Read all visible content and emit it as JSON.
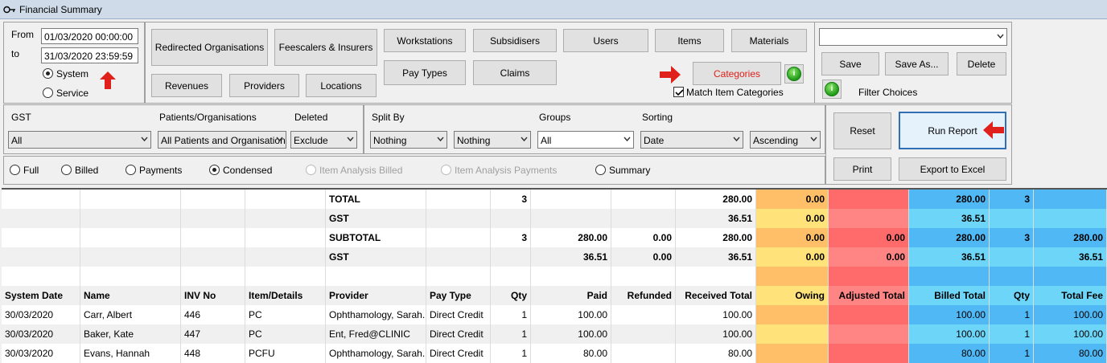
{
  "window": {
    "title": "Financial Summary"
  },
  "date_range": {
    "from_label": "From",
    "to_label": "to",
    "from_value": "01/03/2020 00:00:00",
    "to_value": "31/03/2020 23:59:59",
    "radio_system": "System",
    "radio_service": "Service"
  },
  "buttons": {
    "redirected": "Redirected Organisations",
    "feescalers": "Feescalers & Insurers",
    "workstations": "Workstations",
    "subsidisers": "Subsidisers",
    "users": "Users",
    "items": "Items",
    "materials": "Materials",
    "pay_types": "Pay Types",
    "claims": "Claims",
    "categories": "Categories",
    "revenues": "Revenues",
    "providers": "Providers",
    "locations": "Locations",
    "save": "Save",
    "save_as": "Save As...",
    "delete": "Delete",
    "reset": "Reset",
    "run_report": "Run Report",
    "print": "Print",
    "export": "Export to Excel"
  },
  "match_item_categories": "Match Item Categories",
  "filter_choices": "Filter Choices",
  "filters": {
    "gst_label": "GST",
    "gst_value": "All",
    "patients_label": "Patients/Organisations",
    "patients_value": "All Patients and Organisations",
    "deleted_label": "Deleted",
    "deleted_value": "Exclude",
    "split_label": "Split By",
    "split1_value": "Nothing",
    "split2_value": "Nothing",
    "groups_label": "Groups",
    "groups_value": "All",
    "sorting_label": "Sorting",
    "sorting_value": "Date",
    "order_value": "Ascending"
  },
  "report_types": {
    "full": "Full",
    "billed": "Billed",
    "payments": "Payments",
    "condensed": "Condensed",
    "item_billed": "Item Analysis Billed",
    "item_payments": "Item Analysis Payments",
    "summary": "Summary"
  },
  "colors": {
    "orange": "#ffbf68",
    "yellow": "#ffe27a",
    "red": "#ff6b6b",
    "pink": "#ff8585",
    "blue": "#4fb8f5",
    "lightblue": "#6dd6f8",
    "accent_red": "#e0201a"
  },
  "grid": {
    "totals": [
      [
        "",
        "",
        "",
        "",
        "TOTAL",
        "",
        "3",
        "",
        "",
        "280.00",
        "0.00",
        "",
        "280.00",
        "3",
        ""
      ],
      [
        "",
        "",
        "",
        "",
        "GST",
        "",
        "",
        "",
        "",
        "36.51",
        "0.00",
        "",
        "36.51",
        "",
        ""
      ],
      [
        "",
        "",
        "",
        "",
        "SUBTOTAL",
        "",
        "3",
        "280.00",
        "0.00",
        "280.00",
        "0.00",
        "0.00",
        "280.00",
        "3",
        "280.00"
      ],
      [
        "",
        "",
        "",
        "",
        "GST",
        "",
        "",
        "36.51",
        "0.00",
        "36.51",
        "0.00",
        "0.00",
        "36.51",
        "",
        "36.51"
      ],
      [
        "",
        "",
        "",
        "",
        "",
        "",
        "",
        "",
        "",
        "",
        "",
        "",
        "",
        "",
        ""
      ]
    ],
    "headers": [
      "System Date",
      "Name",
      "INV No",
      "Item/Details",
      "Provider",
      "Pay Type",
      "Qty",
      "Paid",
      "Refunded",
      "Received Total",
      "Owing",
      "Adjusted Total",
      "Billed Total",
      "Qty",
      "Total Fee"
    ],
    "rows": [
      [
        "30/03/2020",
        "Carr, Albert",
        "446",
        "PC",
        "Ophthamology, Sarah...",
        "Direct Credit",
        "1",
        "100.00",
        "",
        "100.00",
        "",
        "",
        "100.00",
        "1",
        "100.00"
      ],
      [
        "30/03/2020",
        "Baker, Kate",
        "447",
        "PC",
        "Ent, Fred@CLINIC",
        "Direct Credit",
        "1",
        "100.00",
        "",
        "100.00",
        "",
        "",
        "100.00",
        "1",
        "100.00"
      ],
      [
        "30/03/2020",
        "Evans, Hannah",
        "448",
        "PCFU",
        "Ophthamology, Sarah...",
        "Direct Credit",
        "1",
        "80.00",
        "",
        "80.00",
        "",
        "",
        "80.00",
        "1",
        "80.00"
      ]
    ]
  }
}
